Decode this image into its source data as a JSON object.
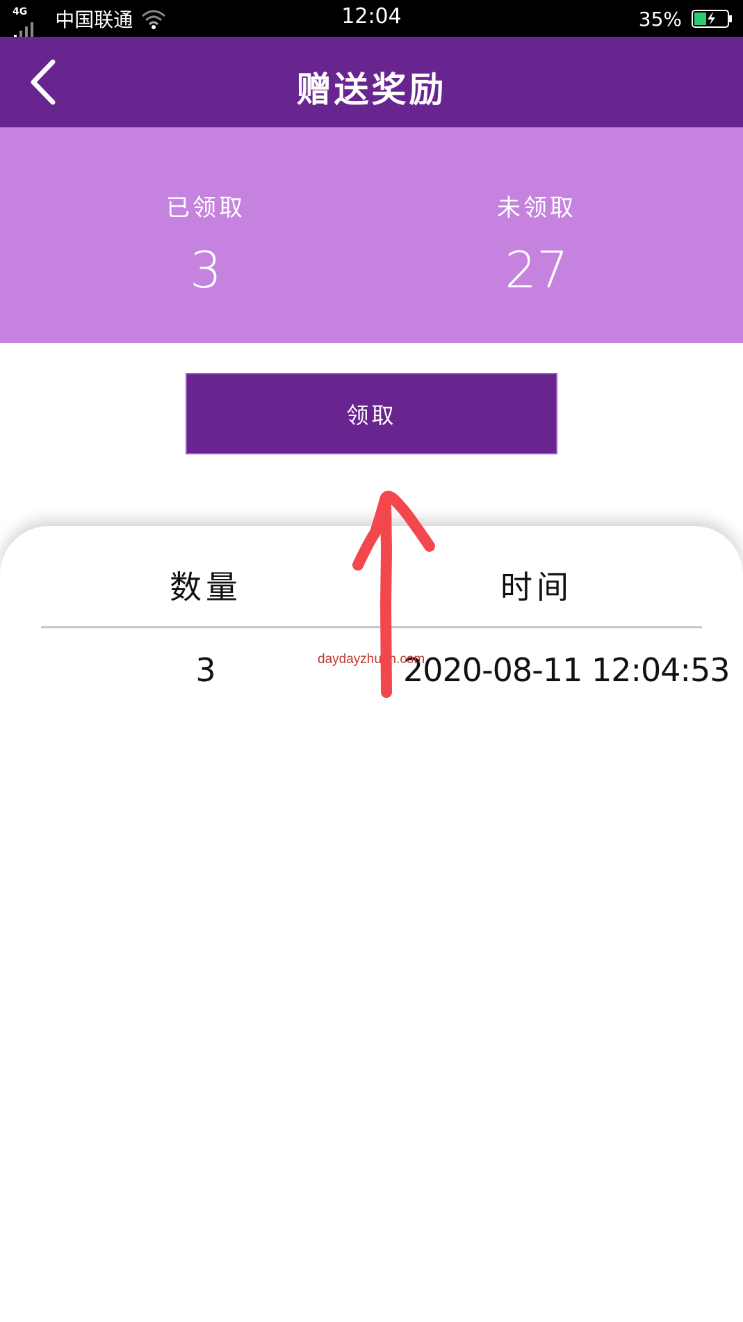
{
  "status_bar": {
    "network_type": "4G",
    "carrier": "中国联通",
    "time": "12:04",
    "battery_percent": "35%",
    "battery_color": "#2ecc71"
  },
  "header": {
    "title": "赠送奖励",
    "back_icon": "chevron-left-icon",
    "background": "#68248f"
  },
  "stats": {
    "claimed_label": "已领取",
    "claimed_value": "3",
    "unclaimed_label": "未领取",
    "unclaimed_value": "27",
    "background": "#c583df"
  },
  "claim_button": {
    "label": "领取"
  },
  "records": {
    "columns": [
      "数量",
      "时间"
    ],
    "rows": [
      {
        "quantity": "3",
        "time": "2020-08-11 12:04:53"
      }
    ]
  },
  "watermark": "daydayzhuan.com",
  "annotation": {
    "color": "#f2474d",
    "icon": "arrow-up-annotation"
  }
}
